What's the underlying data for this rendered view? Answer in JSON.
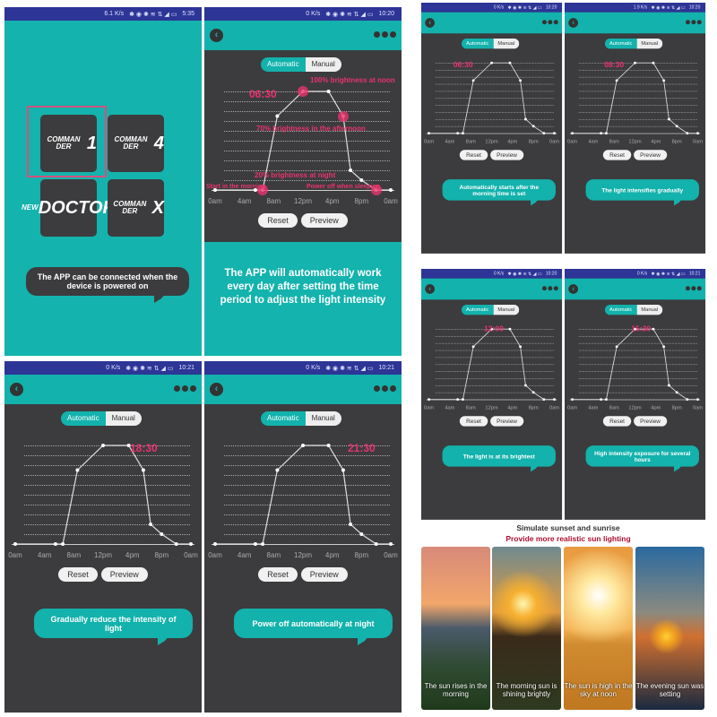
{
  "colors": {
    "teal": "#13b2ac",
    "status_bar": "#2d3596",
    "panel_bg": "#3c3c3e",
    "accent_red": "#e8336d"
  },
  "status_icons": "✱ ◉ ✺ ≋ ⇅ ◢ ▭",
  "home": {
    "status_speed": "6.1 K/s",
    "status_time": "5:35",
    "tiles": [
      {
        "top": "COMMAN DER",
        "big": "1"
      },
      {
        "top": "COMMAN DER",
        "big": "4"
      },
      {
        "top": "NEW",
        "big": "DOCTOR"
      },
      {
        "top": "COMMAN DER",
        "big": "X"
      }
    ],
    "bubble": "The APP can be connected when the device is powered on"
  },
  "chart_common": {
    "toggle": [
      "Automatic",
      "Manual"
    ],
    "x_ticks": [
      "0am",
      "4am",
      "8am",
      "12pm",
      "4pm",
      "8pm",
      "0am"
    ],
    "buttons": [
      "Reset",
      "Preview"
    ]
  },
  "chart_data": {
    "type": "line",
    "x_unit": "hour",
    "y_unit": "brightness %",
    "xlim": [
      0,
      24
    ],
    "ylim": [
      0,
      100
    ],
    "grid": true,
    "x": [
      0,
      5.5,
      6.5,
      8.5,
      12,
      15.5,
      17.5,
      18.5,
      20,
      22,
      24
    ],
    "y": [
      0,
      0,
      0,
      75,
      100,
      100,
      75,
      20,
      10,
      0,
      0
    ]
  },
  "screens": [
    {
      "status_speed": "0 K/s",
      "status_time": "10:20",
      "time_label": "06:30",
      "caption": "The APP will automatically work every day after setting the time period to adjust the light intensity",
      "annotations": [
        "100% brightness at noon",
        "70% brightness in the afternoon",
        "20% brightness at night",
        "Start in the morning",
        "Power off when sleeping"
      ]
    },
    {
      "status_speed": "0 K/s",
      "status_time": "10:20",
      "time_label": "06:30",
      "caption": "Automatically starts after the morning time is set"
    },
    {
      "status_speed": "1.9 K/s",
      "status_time": "10:20",
      "time_label": "08:30",
      "caption": "The light intensifies gradually"
    },
    {
      "status_speed": "0 K/s",
      "status_time": "10:20",
      "time_label": "12:00",
      "caption": "The light is at its brightest"
    },
    {
      "status_speed": "0 K/s",
      "status_time": "10:21",
      "time_label": "15:30",
      "caption": "High intensity exposure for several hours"
    },
    {
      "status_speed": "0 K/s",
      "status_time": "10:21",
      "time_label": "18:30",
      "caption": "Gradually reduce the intensity of light"
    },
    {
      "status_speed": "0 K/s",
      "status_time": "10:21",
      "time_label": "21:30",
      "caption": "Power off automatically at night"
    }
  ],
  "sun": {
    "title": "Simulate sunset and sunrise",
    "subtitle": "Provide more realistic sun lighting",
    "photos": [
      "The sun rises in the morning",
      "The morning sun is shining brightly",
      "The sun is high in the sky at noon",
      "The evening sun was setting"
    ]
  }
}
